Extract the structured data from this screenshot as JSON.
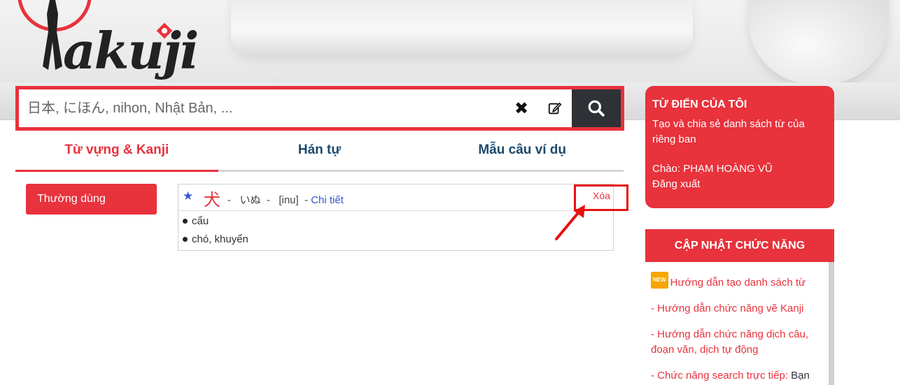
{
  "logo": {
    "text": "akuji"
  },
  "search": {
    "placeholder": "日本, にほん, nihon, Nhật Bản, ...",
    "clear_icon": "✖",
    "edit_icon": "edit-icon",
    "search_icon": "search-icon"
  },
  "tabs": [
    {
      "label": "Từ vựng & Kanji",
      "active": true
    },
    {
      "label": "Hán tự",
      "active": false
    },
    {
      "label": "Mẫu câu ví dụ",
      "active": false
    }
  ],
  "category": {
    "label": "Thường dùng"
  },
  "word": {
    "kanji": "犬",
    "reading": "-   いぬ  -   [inu]  - ",
    "detail_link": "Chi tiết",
    "delete_label": "Xóa",
    "meanings": [
      "cẩu",
      "chó, khuyển"
    ]
  },
  "my_dict": {
    "title": "TỪ ĐIỂN CỦA TÔI",
    "description": "Tạo và chia sẻ danh sách từ của riêng ban",
    "greeting": "Chào: PHẠM HOÀNG VŨ",
    "logout": "Đăng xuất"
  },
  "updates": {
    "title": "CẬP NHẬT CHỨC NĂNG",
    "new_badge": "NEW",
    "items": [
      "Hướng dẫn tạo danh sách từ",
      "- Hướng dẫn chức năng vẽ Kanji",
      "- Hướng dẫn chức năng dịch câu, đoạn văn, dịch tự động",
      "- Chức năng search trực tiếp:"
    ],
    "item4_tail": " Bạn có"
  },
  "colors": {
    "accent": "#e8323c",
    "dark_button": "#2e3135",
    "tab_text": "#1d4a6d",
    "link": "#3558d6"
  }
}
